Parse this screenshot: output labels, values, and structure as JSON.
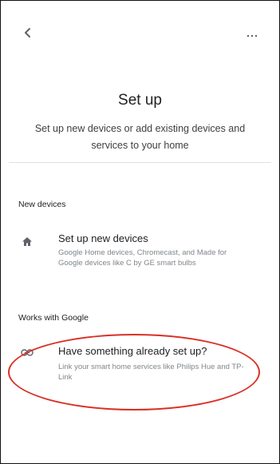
{
  "header": {
    "back_icon": "chevron-left-icon",
    "more_icon": "more-horizontal-icon"
  },
  "page": {
    "title": "Set up",
    "subtitle": "Set up new devices or add existing devices and services to your home"
  },
  "sections": [
    {
      "header": "New devices",
      "items": [
        {
          "icon": "home-icon",
          "title": "Set up new devices",
          "description": "Google Home devices, Chromecast, and Made for Google devices like C by GE smart bulbs"
        }
      ]
    },
    {
      "header": "Works with Google",
      "items": [
        {
          "icon": "link-icon",
          "title": "Have something already set up?",
          "description": "Link your smart home services like Philips Hue and TP-Link"
        }
      ]
    }
  ],
  "colors": {
    "highlight": "#d93025",
    "icon": "#5f6368",
    "muted_text": "#80868b"
  }
}
